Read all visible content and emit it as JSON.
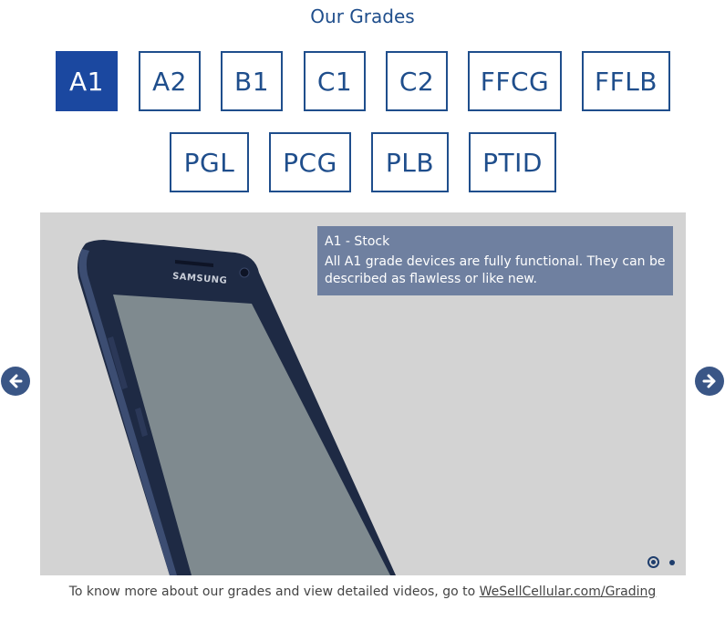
{
  "section_title": "Our Grades",
  "grades": [
    {
      "label": "A1",
      "active": true
    },
    {
      "label": "A2",
      "active": false
    },
    {
      "label": "B1",
      "active": false
    },
    {
      "label": "C1",
      "active": false
    },
    {
      "label": "C2",
      "active": false
    },
    {
      "label": "FFCG",
      "active": false
    },
    {
      "label": "FFLB",
      "active": false
    },
    {
      "label": "PGL",
      "active": false
    },
    {
      "label": "PCG",
      "active": false
    },
    {
      "label": "PLB",
      "active": false
    },
    {
      "label": "PTID",
      "active": false
    }
  ],
  "slide": {
    "caption_title": "A1 - Stock",
    "caption_text": "All A1 grade devices are fully functional. They can be described as flawless or like new.",
    "phone_brand": "SAMSUNG",
    "current_index": 1,
    "total_slides": 2
  },
  "navigation": {
    "prev_icon": "arrow-left-icon",
    "next_icon": "arrow-right-icon"
  },
  "footer": {
    "text": "To know more about our grades and view detailed videos, go to ",
    "link_text": "WeSellCellular.com/Grading"
  },
  "colors": {
    "brand_blue": "#1f4e8c",
    "active_blue": "#1b48a0",
    "caption_bg": "#6f80a0",
    "slider_bg": "#d3d3d3"
  }
}
